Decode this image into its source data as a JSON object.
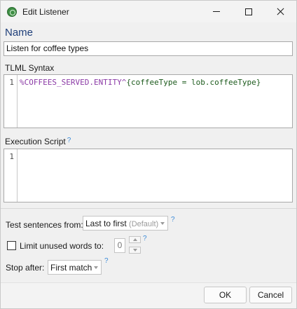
{
  "window": {
    "title": "Edit Listener",
    "icon": "listener-app-icon"
  },
  "name_section": {
    "heading": "Name",
    "value": "Listen for coffee types"
  },
  "tlml": {
    "label": "TLML Syntax",
    "line_number": "1",
    "code_entity": "%COFFEES_SERVED.ENTITY",
    "code_caret": "^",
    "code_rest": "{coffeeType = lob.coffeeType}"
  },
  "execution": {
    "label": "Execution Script",
    "help": "?",
    "line_number": "1",
    "code": ""
  },
  "options": {
    "test_label": "Test sentences from:",
    "test_value": "Last to first",
    "test_value_suffix": "(Default)",
    "test_help": "?",
    "limit_label": "Limit unused words to:",
    "limit_checked": false,
    "limit_value": "0",
    "limit_help": "?",
    "stop_label": "Stop after:",
    "stop_value": "First match",
    "stop_help": "?"
  },
  "footer": {
    "ok_label": "OK",
    "cancel_label": "Cancel"
  },
  "colors": {
    "heading": "#1f3f7a",
    "help": "#3a8ad8",
    "entity": "#8b3aa6",
    "code": "#1c5a1c"
  }
}
